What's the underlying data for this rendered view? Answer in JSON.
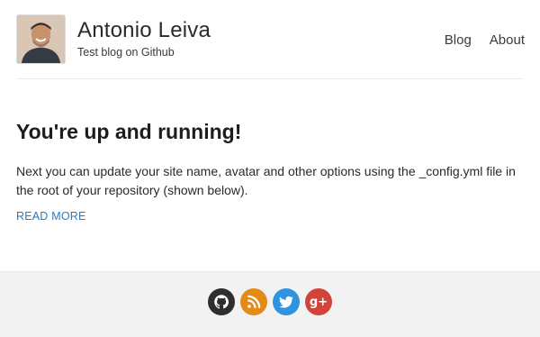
{
  "header": {
    "site_title": "Antonio Leiva",
    "tagline": "Test blog on Github",
    "nav": [
      {
        "label": "Blog"
      },
      {
        "label": "About"
      }
    ]
  },
  "post": {
    "title": "You're up and running!",
    "excerpt": "Next you can update your site name, avatar and other options using the _config.yml file in the root of your repository (shown below).",
    "read_more": "READ MORE"
  },
  "footer": {
    "social": [
      {
        "name": "github-icon",
        "color": "#2e2e2e"
      },
      {
        "name": "rss-icon",
        "color": "#e38b17"
      },
      {
        "name": "twitter-icon",
        "color": "#2f93e0"
      },
      {
        "name": "google-plus-icon",
        "color": "#d2433a",
        "glyph": "g+"
      }
    ]
  },
  "colors": {
    "link": "#2a7abf",
    "footer_bg": "#f2f2f2",
    "text": "#1f1f1f"
  }
}
